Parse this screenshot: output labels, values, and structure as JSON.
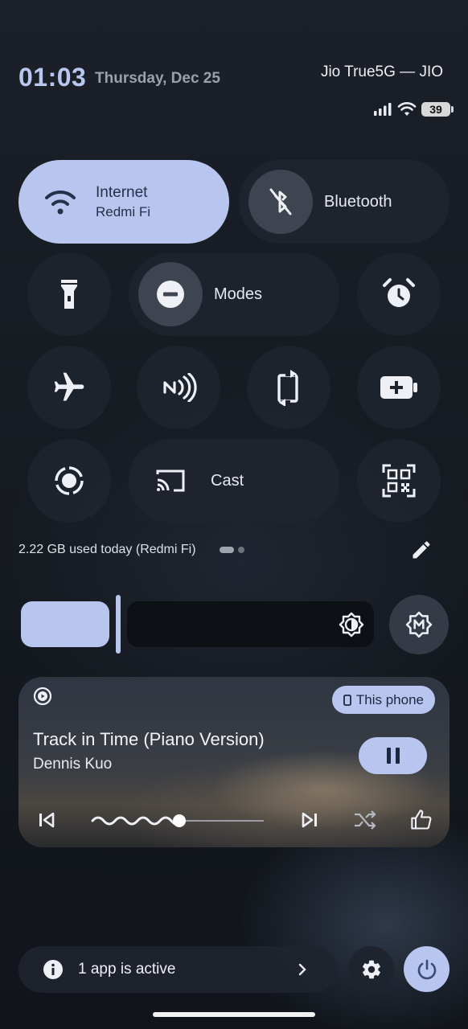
{
  "status_bar": {
    "time": "01:03",
    "date": "Thursday, Dec 25",
    "carrier": "Jio True5G — JIO",
    "battery_level": "39"
  },
  "tiles": {
    "internet": {
      "label": "Internet",
      "sublabel": "Redmi Fi",
      "icon": "wifi-icon"
    },
    "bluetooth": {
      "label": "Bluetooth",
      "icon": "bluetooth-off-icon"
    },
    "flashlight": {
      "icon": "flashlight-icon"
    },
    "modes": {
      "label": "Modes",
      "icon": "do-not-disturb-icon"
    },
    "alarm": {
      "icon": "alarm-icon"
    },
    "airplane": {
      "icon": "airplane-icon"
    },
    "nfc": {
      "icon": "nfc-icon"
    },
    "rotate": {
      "icon": "auto-rotate-icon"
    },
    "battery_saver": {
      "icon": "battery-saver-icon"
    },
    "screen_record": {
      "icon": "screen-record-icon"
    },
    "cast": {
      "label": "Cast",
      "icon": "cast-icon"
    },
    "qr_scanner": {
      "icon": "qr-scanner-icon"
    }
  },
  "data_usage": "2.22 GB used today (Redmi Fi)",
  "brightness": {
    "level": 0.28
  },
  "media": {
    "output_device": "This phone",
    "title": "Track in Time (Piano Version)",
    "artist": "Dennis Kuo",
    "progress": 0.5
  },
  "footer": {
    "active_apps": "1 app is active"
  },
  "colors": {
    "accent": "#b8c6ef",
    "tile_bg": "#1e242e",
    "clock": "#b9c7ee"
  }
}
